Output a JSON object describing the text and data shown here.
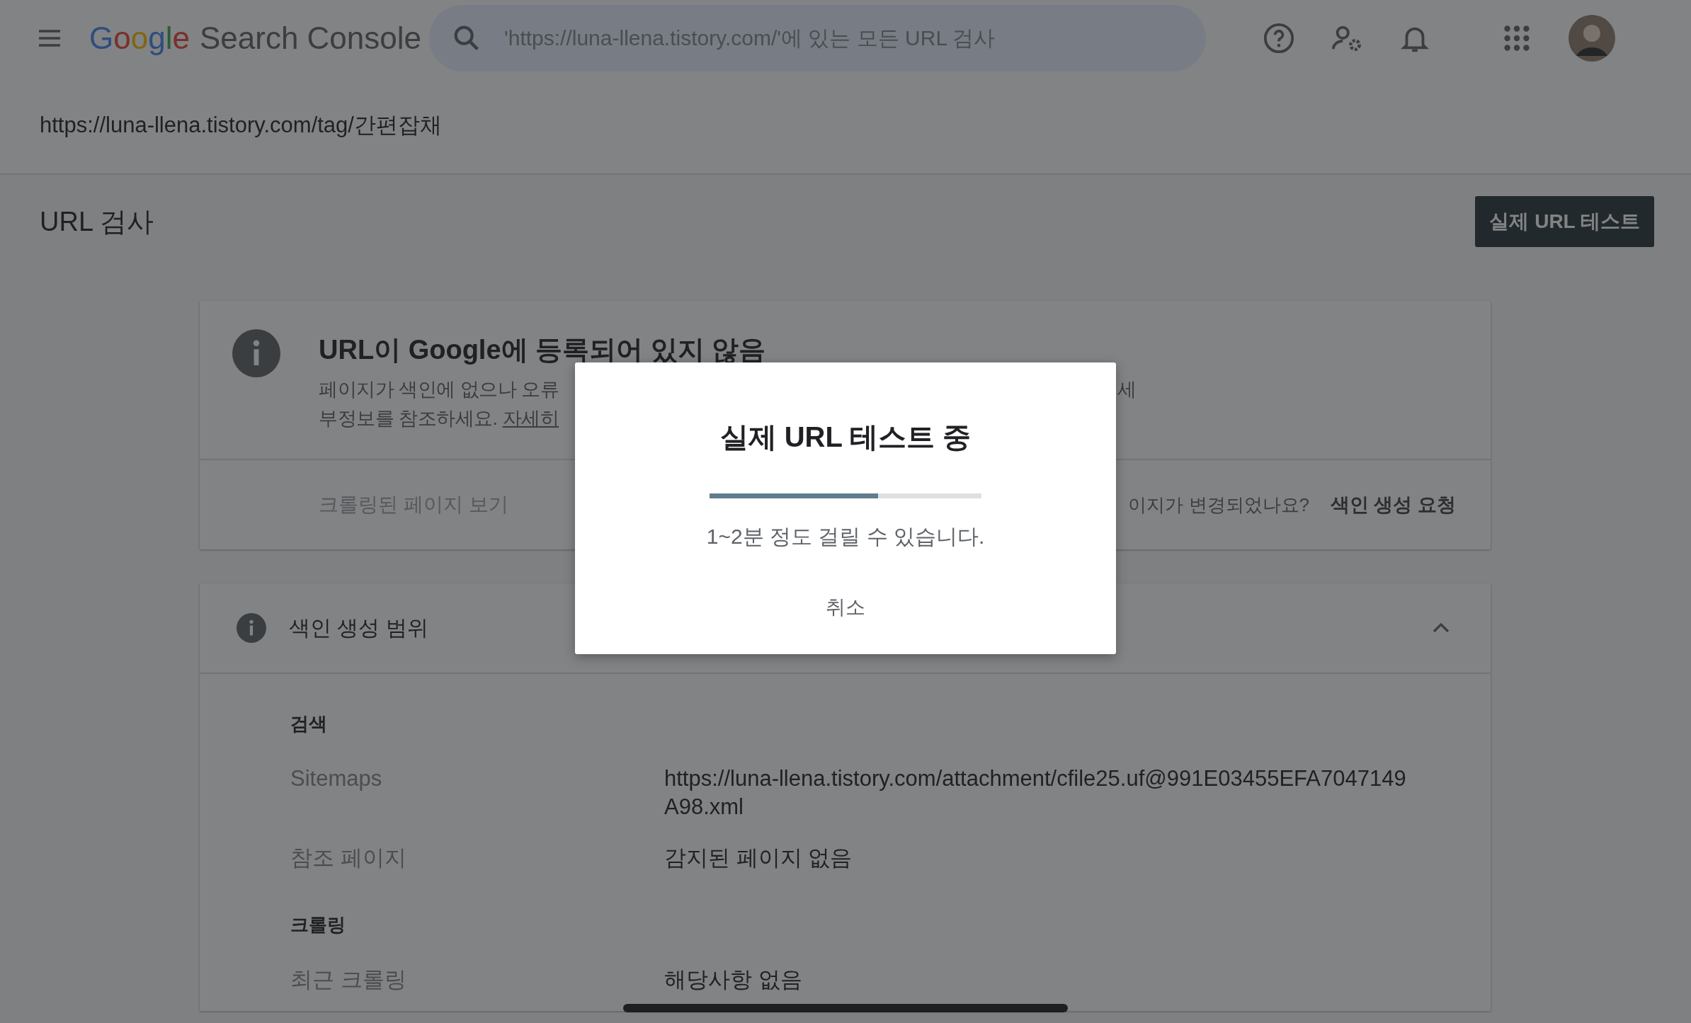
{
  "header": {
    "logo_brand": "Google",
    "logo_product": "Search Console",
    "search": {
      "placeholder": "'https://luna-llena.tistory.com/'에 있는 모든 URL 검사"
    }
  },
  "inspected_url": "https://luna-llena.tistory.com/tag/간편잡채",
  "page": {
    "title": "URL 검사",
    "live_test_button": "실제 URL 테스트"
  },
  "status_card": {
    "title": "URL이 Google에 등록되어 있지 않음",
    "description_left": "페이지가 색인에 없으나 오류",
    "description_right": "세",
    "description_line2": "부정보를 참조하세요.",
    "learn_more_link": "자세히",
    "view_crawled_link": "크롤링된 페이지 보기",
    "changed_question": "이지가 변경되었나요?",
    "request_indexing_button": "색인 생성 요청"
  },
  "coverage": {
    "title": "색인 생성 범위",
    "expanded": true,
    "sections": [
      {
        "heading": "검색",
        "rows": [
          {
            "label": "Sitemaps",
            "value": "https://luna-llena.tistory.com/attachment/cfile25.uf@991E03455EFA7047149A98.xml"
          },
          {
            "label": "참조 페이지",
            "value": "감지된 페이지 없음"
          }
        ]
      },
      {
        "heading": "크롤링",
        "rows": [
          {
            "label": "최근 크롤링",
            "value": "해당사항 없음"
          }
        ]
      }
    ]
  },
  "dialog": {
    "title": "실제 URL 테스트 중",
    "level": 0.62,
    "message": "1~2분 정도 걸릴 수 있습니다.",
    "cancel_button": "취소"
  }
}
